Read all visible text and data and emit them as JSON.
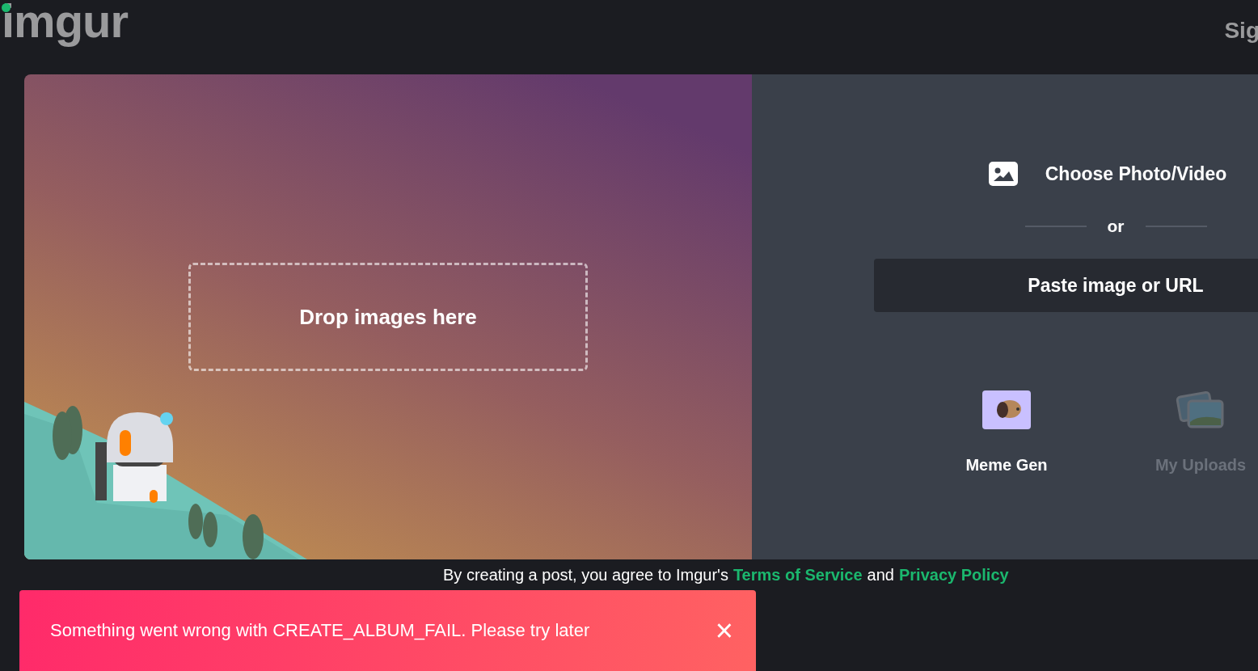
{
  "header": {
    "logo": "imgur",
    "sign_in": "Sig"
  },
  "upload": {
    "drop_zone": "Drop images here",
    "choose": "Choose Photo/Video",
    "divider": "or",
    "paste": "Paste image or URL",
    "tools": [
      {
        "label": "Meme Gen",
        "kind": "meme",
        "disabled": false
      },
      {
        "label": "My Uploads",
        "kind": "uploads",
        "disabled": true
      }
    ]
  },
  "footer": {
    "text": "By creating a post, you agree to Imgur's",
    "terms": "Terms of Service",
    "and": "and",
    "privacy": "Privacy Policy"
  },
  "toast": {
    "message": "Something went wrong with CREATE_ALBUM_FAIL. Please try later",
    "close": "×"
  }
}
